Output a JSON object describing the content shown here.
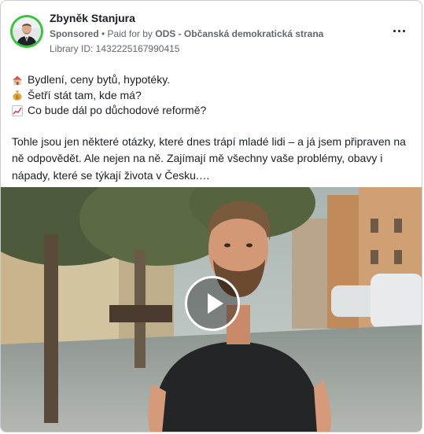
{
  "post": {
    "author": "Zbyněk Stanjura",
    "sponsored": "Sponsored",
    "separator": " • ",
    "paid_for_by_prefix": "Paid for by ",
    "paid_for_by": "ODS - Občanská demokratická strana",
    "library_id": "Library ID: 1432225167990415"
  },
  "content": {
    "lines": [
      {
        "icon": "house-icon",
        "text": "Bydlení, ceny bytů, hypotéky."
      },
      {
        "icon": "money-bag-icon",
        "text": "Šetří stát tam, kde má?"
      },
      {
        "icon": "chart-increasing-icon",
        "text": "Co bude dál po důchodové reformě?"
      }
    ],
    "paragraph": "Tohle jsou jen některé otázky, které dnes trápí mladé lidi – a já jsem připraven na ně odpovědět. Ale nejen na ně. Zajímají mě všechny vaše problémy, obavy i nápady, které se týkají života v Česku.…"
  },
  "colors": {
    "avatar_ring": "#36c538",
    "text": "#1c1e21",
    "secondary": "#65676b"
  }
}
